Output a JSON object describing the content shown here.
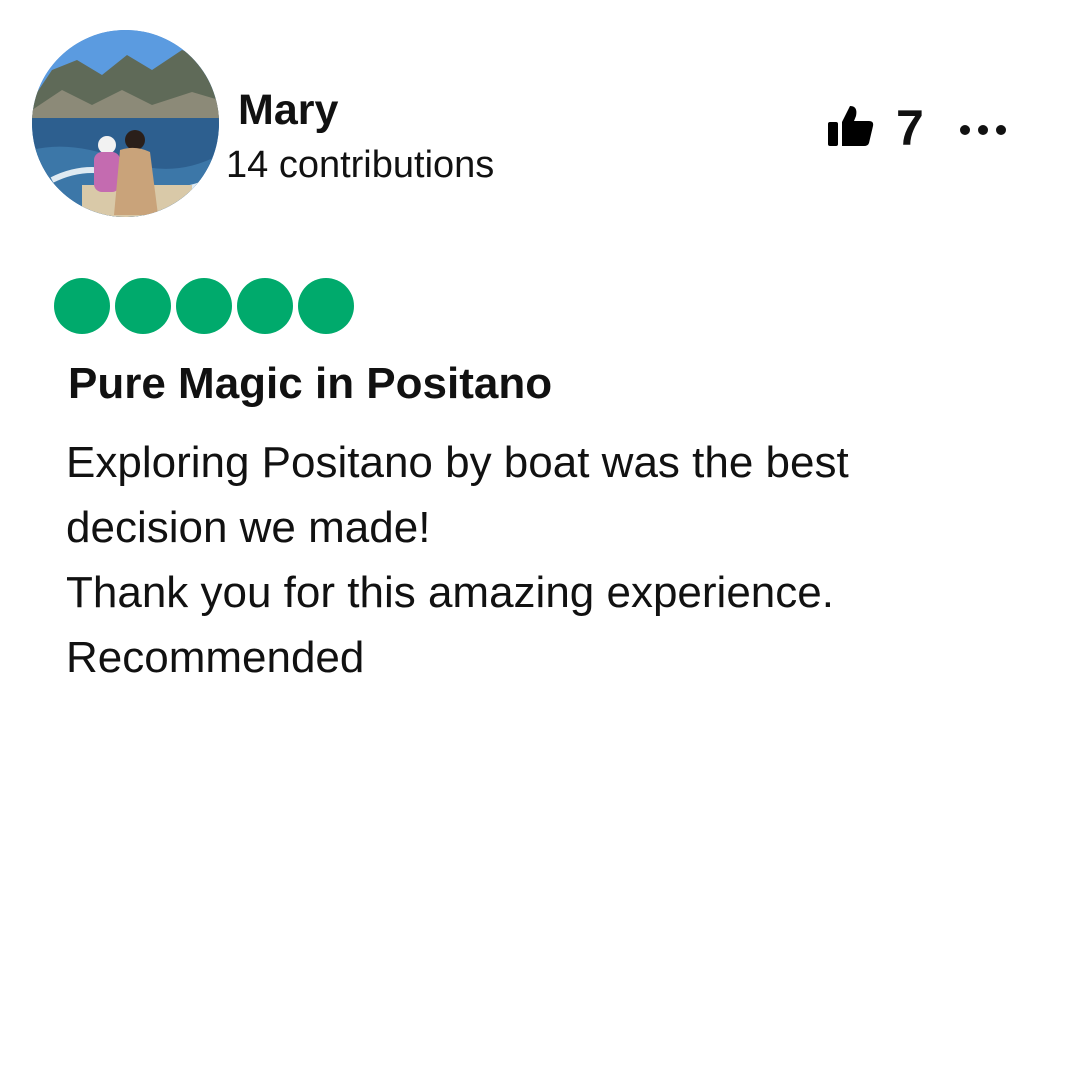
{
  "user": {
    "name": "Mary",
    "contributions": "14 contributions",
    "avatar_icon": "avatar-photo"
  },
  "actions": {
    "like_icon": "thumbs-up-icon",
    "like_count": "7",
    "more_icon": "more-options-icon"
  },
  "rating": {
    "value": 5,
    "max": 5,
    "color": "#00aa6c"
  },
  "review": {
    "title": "Pure Magic in Positano",
    "lines": [
      "Exploring Positano by boat was the best",
      "decision we made!",
      "Thank you for this amazing experience.",
      "Recommended"
    ]
  }
}
